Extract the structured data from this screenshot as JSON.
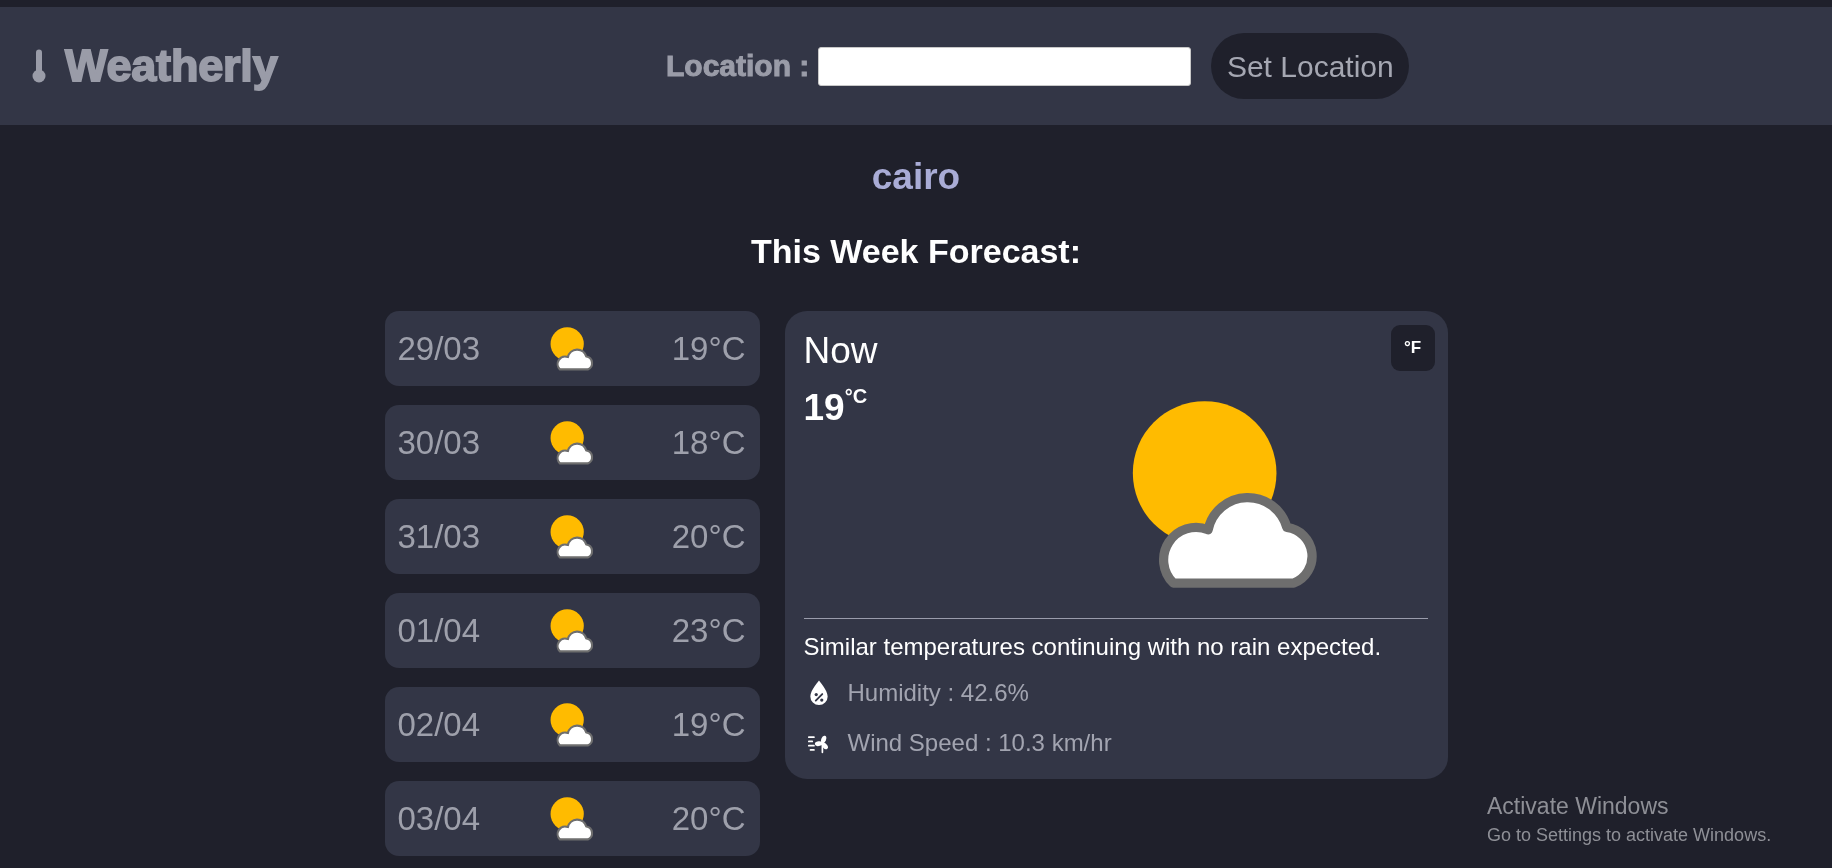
{
  "header": {
    "brand": "Weatherly",
    "location_label": "Location :",
    "set_button": "Set Location"
  },
  "city": "cairo",
  "forecast_title": "This Week Forecast:",
  "days": [
    {
      "date": "29/03",
      "temp": "19°C"
    },
    {
      "date": "30/03",
      "temp": "18°C"
    },
    {
      "date": "31/03",
      "temp": "20°C"
    },
    {
      "date": "01/04",
      "temp": "23°C"
    },
    {
      "date": "02/04",
      "temp": "19°C"
    },
    {
      "date": "03/04",
      "temp": "20°C"
    }
  ],
  "now": {
    "title": "Now",
    "temp": "19$^{°C}$",
    "unit_button": "°F",
    "description": "Similar temperatures continuing with no rain expected.",
    "details": [
      {
        "kind": "humidity",
        "text": "Humidity : 42.6%"
      },
      {
        "kind": "wind",
        "text": "Wind Speed : 10.3 km/hr"
      }
    ]
  },
  "windows_notice": {
    "title": "Activate Windows",
    "subtitle": "Go to Settings to activate Windows."
  }
}
